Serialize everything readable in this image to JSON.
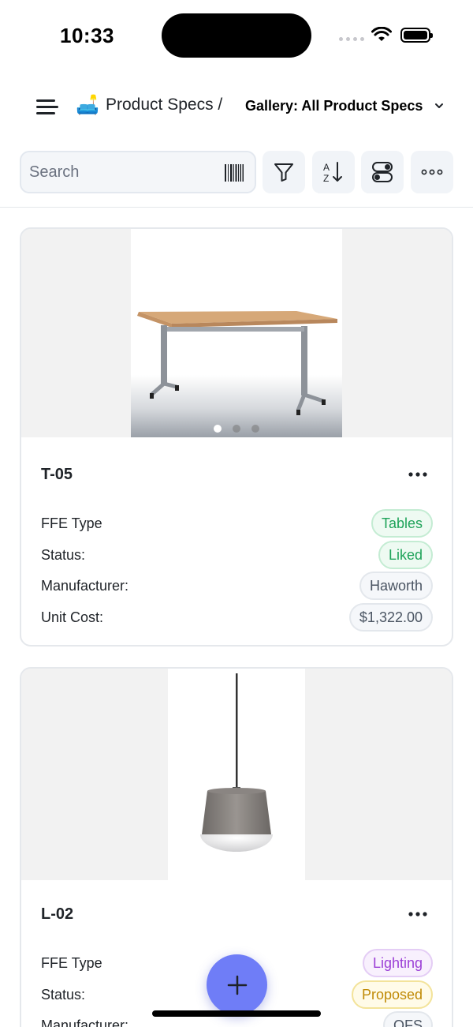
{
  "status_bar": {
    "time": "10:33"
  },
  "header": {
    "app_icon": "🛋️",
    "breadcrumb": "Product Specs /",
    "view_title": "Gallery: All Product Specs"
  },
  "toolbar": {
    "search_placeholder": "Search",
    "icons": [
      "barcode-icon",
      "filter-icon",
      "sort-az-icon",
      "toggle-fields-icon",
      "more-icon"
    ]
  },
  "labels": {
    "ffe_type": "FFE Type",
    "status": "Status:",
    "manufacturer": "Manufacturer:",
    "unit_cost": "Unit Cost:"
  },
  "cards": [
    {
      "title": "T-05",
      "ffe_type": "Tables",
      "status": "Liked",
      "manufacturer": "Haworth",
      "unit_cost": "$1,322.00",
      "image": "folding-table-photo",
      "image_count": 3,
      "active_image": 1
    },
    {
      "title": "L-02",
      "ffe_type": "Lighting",
      "status": "Proposed",
      "manufacturer": "OFS",
      "image": "pendant-lamp-photo"
    }
  ],
  "colors": {
    "accent": "#6f7df7",
    "tag_green": "#1fa35a",
    "tag_purple": "#9b3fd6",
    "tag_yellow": "#c08a06"
  }
}
